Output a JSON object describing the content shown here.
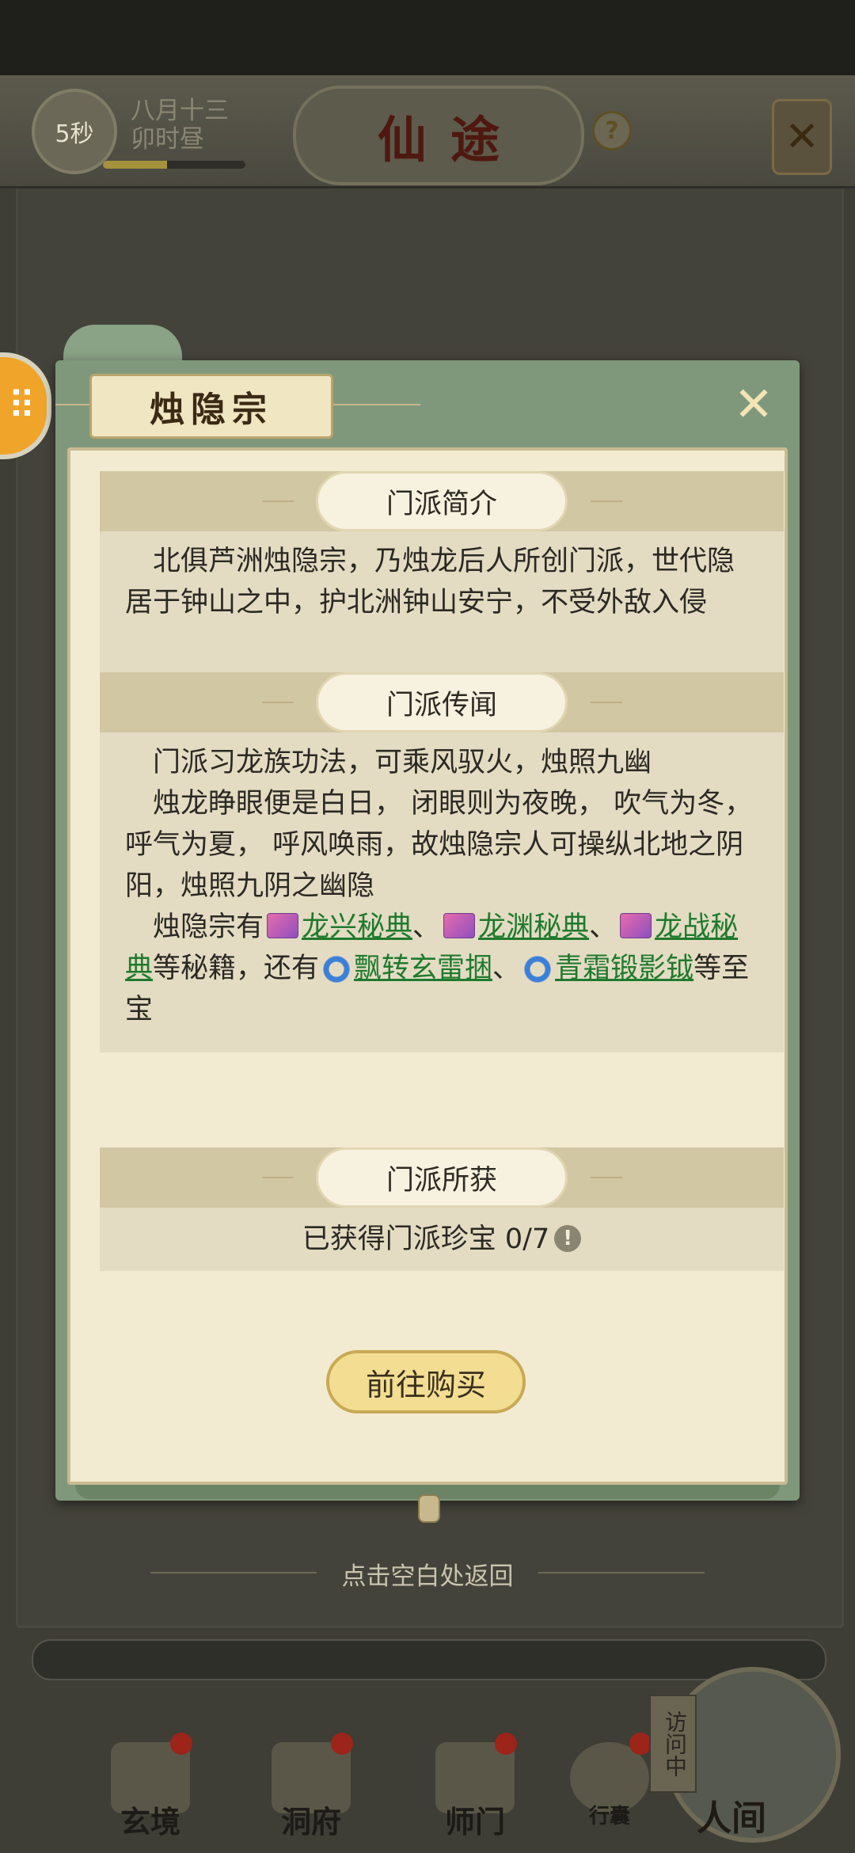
{
  "hud": {
    "timer": "5秒",
    "date_line1": "八月十三",
    "date_line2": "卯时昼",
    "time_progress_pct": 45,
    "title": "仙途",
    "help": "?"
  },
  "popup": {
    "title": "烛隐宗",
    "sections": {
      "intro": {
        "header": "门派简介",
        "text": "北俱芦洲烛隐宗，乃烛龙后人所创门派，世代隐居于钟山之中，护北洲钟山安宁，不受外敌入侵"
      },
      "lore": {
        "header": "门派传闻",
        "line1": "门派习龙族功法，可乘风驭火，烛照九幽",
        "line2": "烛龙睁眼便是白日， 闭眼则为夜晚， 吹气为冬， 呼气为夏， 呼风唤雨，故烛隐宗人可操纵北地之阴阳，烛照九阴之幽隐",
        "line3_prefix": "烛隐宗有",
        "book1": "龙兴秘典",
        "book2": "龙渊秘典",
        "book3": "龙战秘典",
        "sep": "、",
        "mid_text": "等秘籍，还有",
        "treasure1": "飘转玄雷捆",
        "treasure2": "青霜锻影钺",
        "suffix": "等至宝"
      },
      "gains": {
        "header": "门派所获",
        "text": "已获得门派珍宝 0/7",
        "alert": "!"
      }
    },
    "buy_button": "前往购买"
  },
  "tap_hint": "点击空白处返回",
  "nav": {
    "items": [
      {
        "label": "玄境"
      },
      {
        "label": "洞府"
      },
      {
        "label": "师门"
      },
      {
        "label": "行囊"
      }
    ],
    "visit_tag": "访问中",
    "world": "人间"
  },
  "colors": {
    "popup_frame": "#7f987b",
    "paper": "#f2ebd1",
    "section_band": "#d2c7a3",
    "link_green": "#1f7a2d",
    "button_gold": "#f2dd92"
  }
}
